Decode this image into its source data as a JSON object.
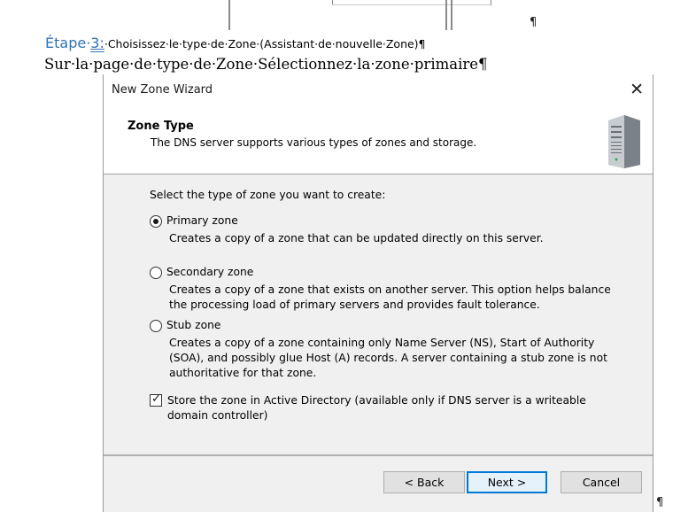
{
  "doc": {
    "heading_prefix": "Étape·",
    "heading_number": "3:",
    "heading_text": "·Choisissez·le·type·de·Zone·(Assistant·de·nouvelle·Zone)¶",
    "subtext": "Sur·la·page·de·type·de·Zone·Sélectionnez·la·zone·primaire¶",
    "pilcrow": "¶"
  },
  "wizard": {
    "title": "New Zone Wizard",
    "close_glyph": "✕",
    "header": {
      "title": "Zone Type",
      "description": "The DNS server supports various types of zones and storage."
    },
    "prompt": "Select the type of zone you want to create:",
    "options": [
      {
        "label": "Primary zone",
        "selected": true,
        "description": "Creates a copy of a zone that can be updated directly on this server."
      },
      {
        "label": "Secondary zone",
        "selected": false,
        "description": "Creates a copy of a zone that exists on another server. This option helps balance the processing load of primary servers and provides fault tolerance."
      },
      {
        "label": "Stub zone",
        "selected": false,
        "description": "Creates a copy of a zone containing only Name Server (NS), Start of Authority (SOA), and possibly glue Host (A) records. A server containing a stub zone is not authoritative for that zone."
      }
    ],
    "store_ad": {
      "checked": true,
      "label": "Store the zone in Active Directory (available only if DNS server is a writeable domain controller)"
    },
    "buttons": {
      "back": "< Back",
      "next": "Next >",
      "cancel": "Cancel"
    }
  }
}
